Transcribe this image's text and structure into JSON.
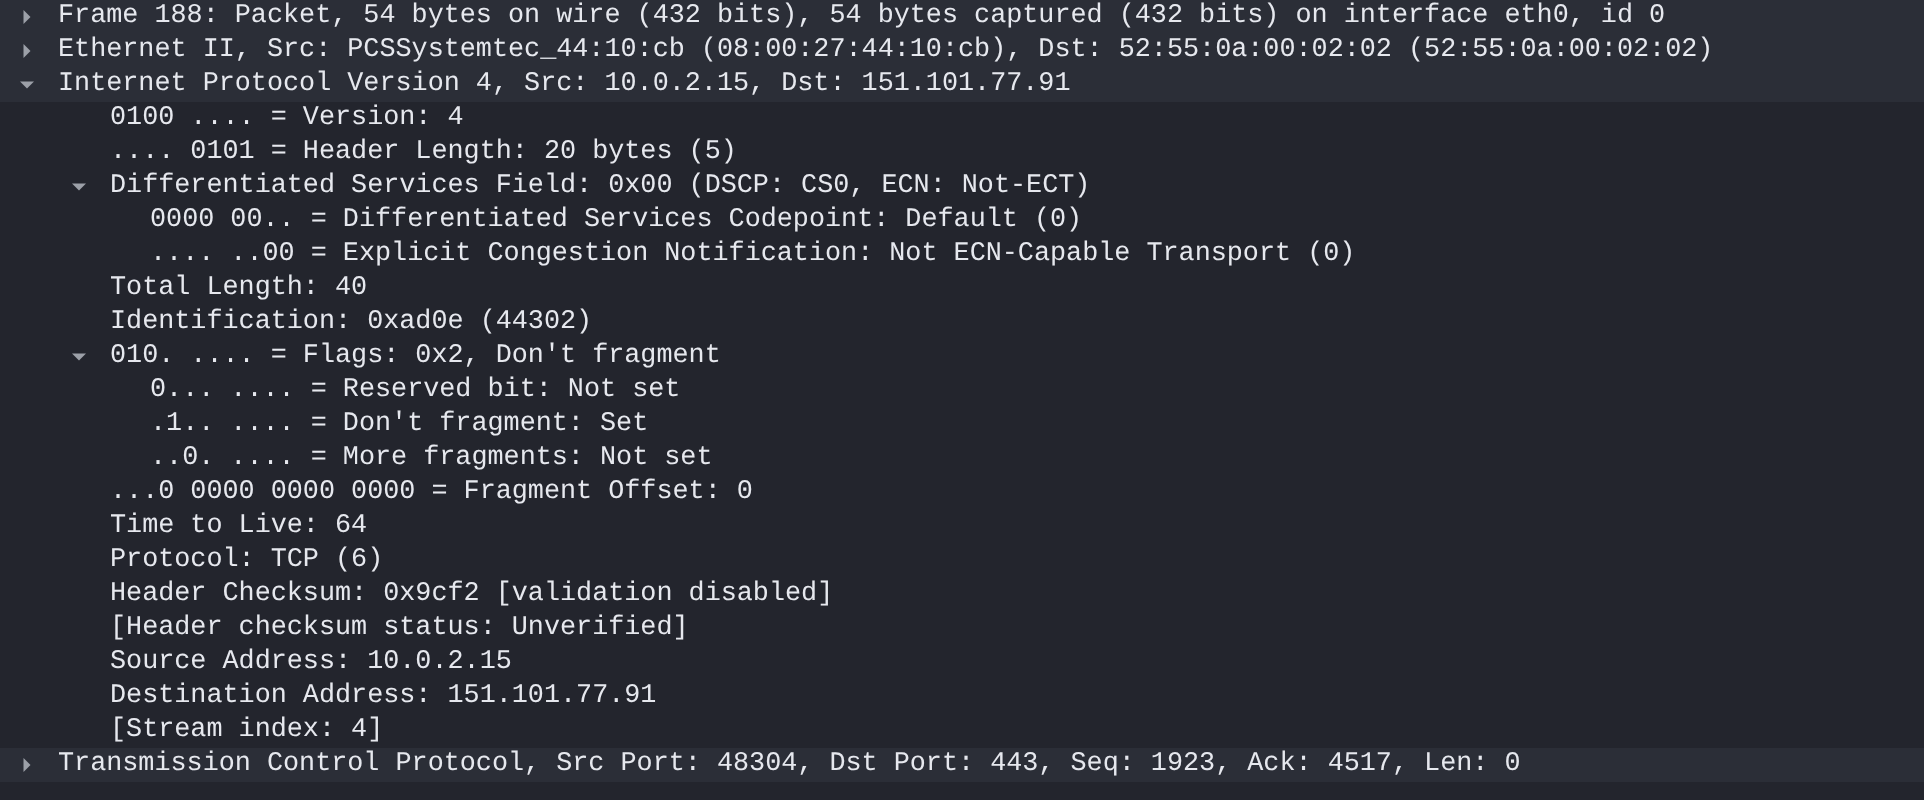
{
  "tree": [
    {
      "label": "Frame 188: Packet, 54 bytes on wire (432 bits), 54 bytes captured (432 bits) on interface eth0, id 0",
      "expanded": false
    },
    {
      "label": "Ethernet II, Src: PCSSystemtec_44:10:cb (08:00:27:44:10:cb), Dst: 52:55:0a:00:02:02 (52:55:0a:00:02:02)",
      "expanded": false
    },
    {
      "label": "Internet Protocol Version 4, Src: 10.0.2.15, Dst: 151.101.77.91",
      "expanded": true,
      "children": [
        {
          "label": "0100 .... = Version: 4"
        },
        {
          "label": ".... 0101 = Header Length: 20 bytes (5)"
        },
        {
          "label": "Differentiated Services Field: 0x00 (DSCP: CS0, ECN: Not-ECT)",
          "expanded": true,
          "children": [
            {
              "label": "0000 00.. = Differentiated Services Codepoint: Default (0)"
            },
            {
              "label": ".... ..00 = Explicit Congestion Notification: Not ECN-Capable Transport (0)"
            }
          ]
        },
        {
          "label": "Total Length: 40"
        },
        {
          "label": "Identification: 0xad0e (44302)"
        },
        {
          "label": "010. .... = Flags: 0x2, Don't fragment",
          "expanded": true,
          "children": [
            {
              "label": "0... .... = Reserved bit: Not set"
            },
            {
              "label": ".1.. .... = Don't fragment: Set"
            },
            {
              "label": "..0. .... = More fragments: Not set"
            }
          ]
        },
        {
          "label": "...0 0000 0000 0000 = Fragment Offset: 0"
        },
        {
          "label": "Time to Live: 64"
        },
        {
          "label": "Protocol: TCP (6)"
        },
        {
          "label": "Header Checksum: 0x9cf2 [validation disabled]"
        },
        {
          "label": "[Header checksum status: Unverified]"
        },
        {
          "label": "Source Address: 10.0.2.15"
        },
        {
          "label": "Destination Address: 151.101.77.91"
        },
        {
          "label": "[Stream index: 4]"
        }
      ]
    },
    {
      "label": "Transmission Control Protocol, Src Port: 48304, Dst Port: 443, Seq: 1923, Ack: 4517, Len: 0",
      "expanded": false
    }
  ]
}
